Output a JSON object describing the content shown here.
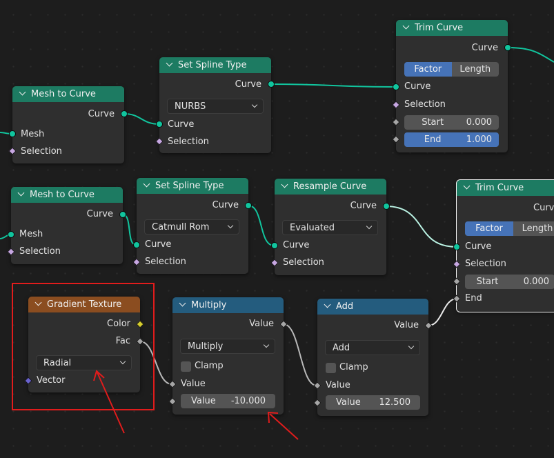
{
  "colors": {
    "background": "#1d1d1d",
    "geometry_socket": "#11c59e",
    "header_geometry": "#1d7b62",
    "header_math": "#245c7e",
    "header_texture": "#8b4d20",
    "active_button": "#4673b8",
    "annotation": "#e11c1c"
  },
  "nodes": {
    "mesh_to_curve_1": {
      "title": "Mesh to Curve",
      "out_curve": "Curve",
      "in_mesh": "Mesh",
      "in_selection": "Selection"
    },
    "set_spline_type_1": {
      "title": "Set Spline Type",
      "out_curve": "Curve",
      "mode": "NURBS",
      "in_curve": "Curve",
      "in_selection": "Selection"
    },
    "trim_curve_1": {
      "title": "Trim Curve",
      "out_curve": "Curve",
      "mode_factor": "Factor",
      "mode_length": "Length",
      "in_curve": "Curve",
      "in_selection": "Selection",
      "start_label": "Start",
      "start_value": "0.000",
      "end_label": "End",
      "end_value": "1.000"
    },
    "mesh_to_curve_2": {
      "title": "Mesh to Curve",
      "out_curve": "Curve",
      "in_mesh": "Mesh",
      "in_selection": "Selection"
    },
    "set_spline_type_2": {
      "title": "Set Spline Type",
      "out_curve": "Curve",
      "mode": "Catmull Rom",
      "in_curve": "Curve",
      "in_selection": "Selection"
    },
    "resample_curve": {
      "title": "Resample Curve",
      "out_curve": "Curve",
      "mode": "Evaluated",
      "in_curve": "Curve",
      "in_selection": "Selection"
    },
    "trim_curve_2": {
      "title": "Trim Curve",
      "out_curve": "Curve",
      "mode_factor": "Factor",
      "mode_length": "Length",
      "in_curve": "Curve",
      "in_selection": "Selection",
      "start_label": "Start",
      "start_value": "0.000",
      "end_label": "End"
    },
    "gradient_texture": {
      "title": "Gradient Texture",
      "out_color": "Color",
      "out_fac": "Fac",
      "type": "Radial",
      "in_vector": "Vector"
    },
    "multiply": {
      "title": "Multiply",
      "out_value": "Value",
      "operation": "Multiply",
      "clamp": "Clamp",
      "in_value": "Value",
      "value_label": "Value",
      "value": "-10.000"
    },
    "add": {
      "title": "Add",
      "out_value": "Value",
      "operation": "Add",
      "clamp": "Clamp",
      "in_value": "Value",
      "value_label": "Value",
      "value": "12.500"
    }
  }
}
